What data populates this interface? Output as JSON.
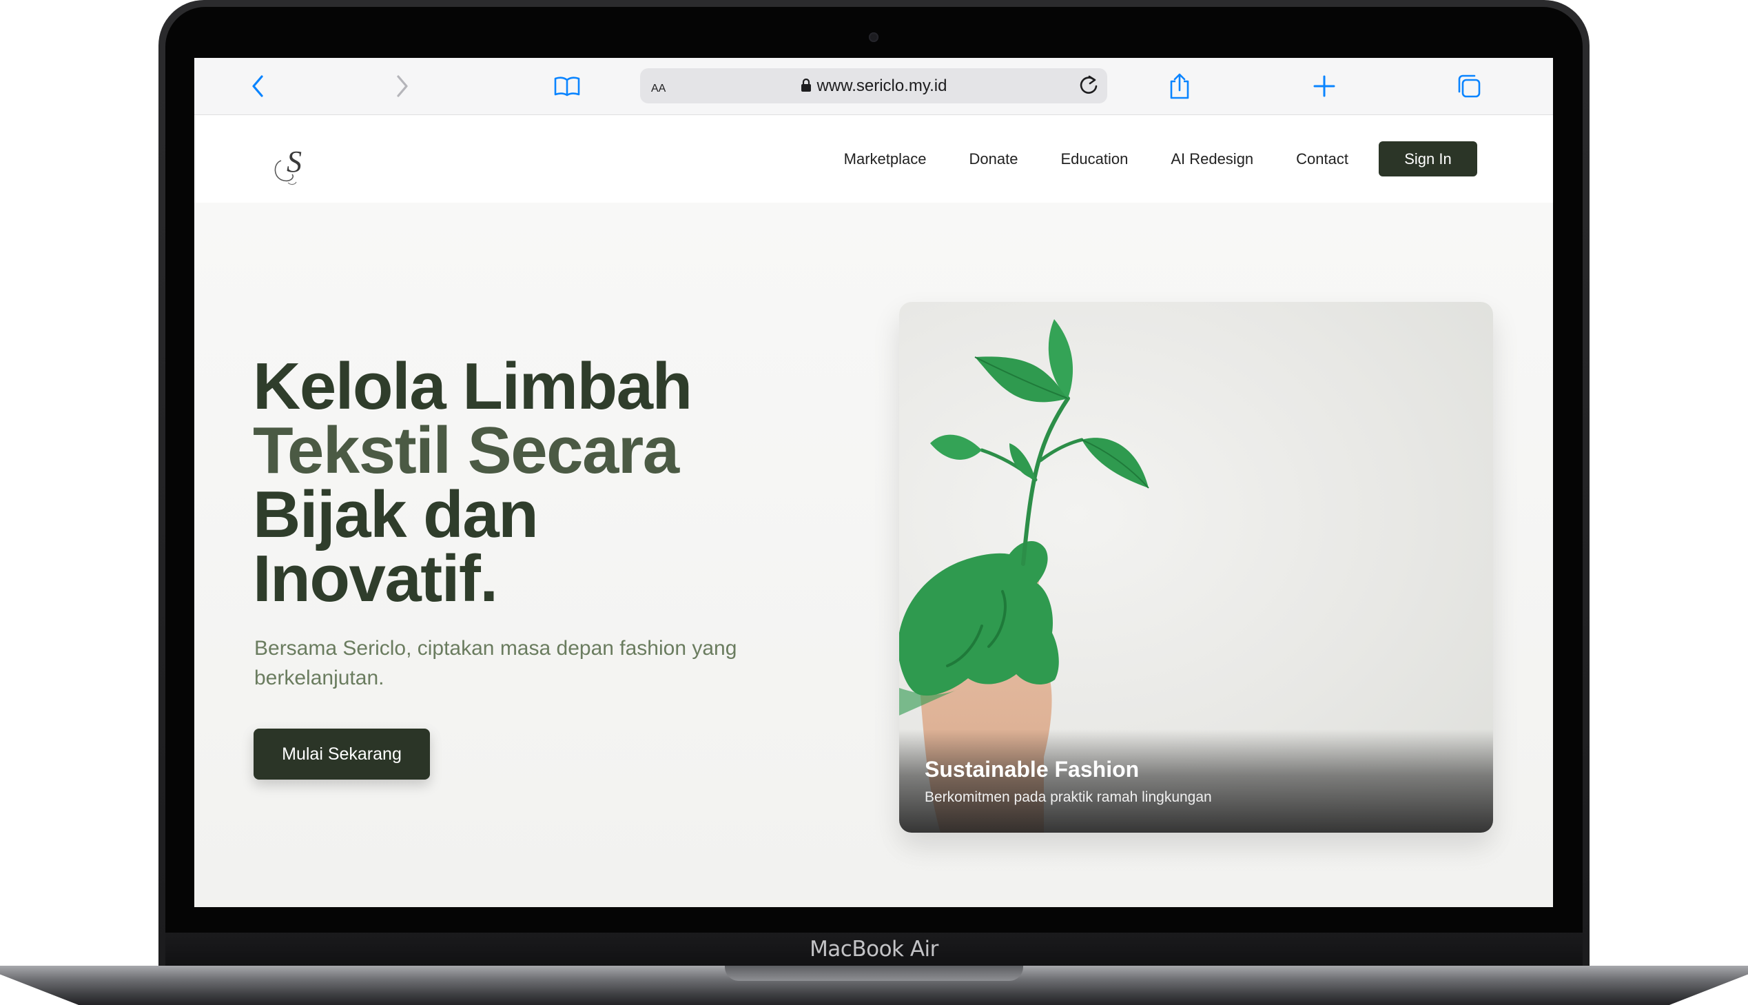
{
  "device": {
    "label": "MacBook Air"
  },
  "browser": {
    "reader_label": "AA",
    "url": "www.sericlo.my.id",
    "icons": [
      "back-icon",
      "forward-icon",
      "bookmarks-icon",
      "lock-icon",
      "reload-icon",
      "share-icon",
      "new-tab-icon",
      "tabs-icon"
    ],
    "accent": "#0a84ff"
  },
  "nav": {
    "logo_letter": "S",
    "links": [
      "Marketplace",
      "Donate",
      "Education",
      "AI Redesign",
      "Contact"
    ],
    "signin_label": "Sign In"
  },
  "hero": {
    "title_lines": [
      "Kelola Limbah",
      "Tekstil Secara",
      "Bijak dan",
      "Inovatif."
    ],
    "subtitle": "Bersama Sericlo, ciptakan masa depan fashion yang berkelanjutan.",
    "cta_label": "Mulai Sekarang"
  },
  "card": {
    "title": "Sustainable Fashion",
    "description": "Berkomitmen pada praktik ramah lingkungan"
  },
  "colors": {
    "brand_dark": "#2b3527",
    "leaf_green": "#2f9a4f",
    "subtitle_green": "#6a7c5f"
  }
}
